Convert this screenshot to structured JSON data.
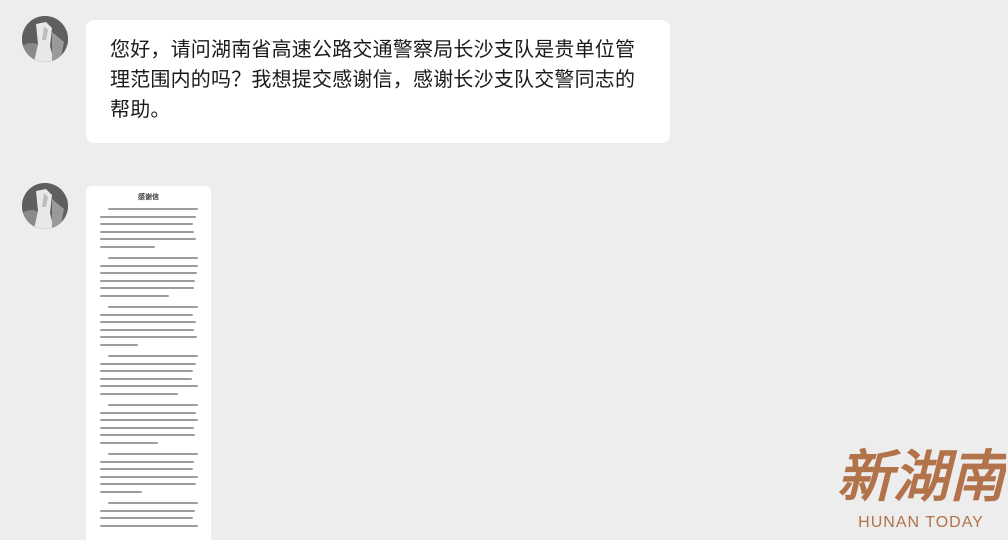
{
  "chat": {
    "messages": [
      {
        "sender_avatar": "avatar-icon",
        "text": "您好，请问湖南省高速公路交通警察局长沙支队是贵单位管理范围内的吗？我想提交感谢信，感谢长沙支队交警同志的帮助。"
      },
      {
        "sender_avatar": "avatar-icon",
        "attachment": {
          "type": "document-image",
          "title": "感谢信"
        }
      }
    ]
  },
  "watermark": {
    "logo_text": "新湖南",
    "sub_text": "HUNAN TODAY",
    "color": "#b2724a"
  }
}
